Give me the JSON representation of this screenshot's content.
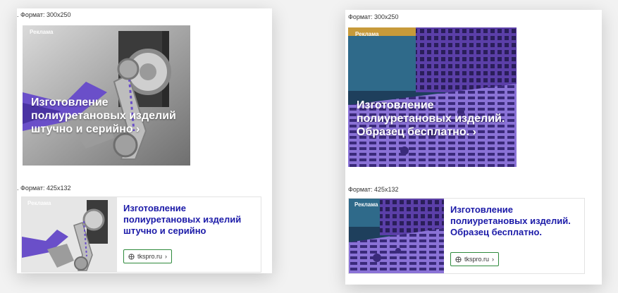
{
  "left": {
    "format_big": ". Формат: 300x250",
    "format_small": ". Формат: 425x132",
    "ad_badge": "Реклама",
    "big_title": "Изготовление полиуретановых изделий штучно и серийно ›",
    "small_title": "Изготовление полиуретановых изделий штучно и серийно",
    "domain": "tkspro.ru",
    "arrow": "›"
  },
  "right": {
    "format_big": "Формат: 300x250",
    "format_small": "Формат: 425x132",
    "ad_badge": "Реклама",
    "big_title": "Изготовление полиуретановых изделий. Образец бесплатно. ›",
    "small_title": "Изготовление полиуретановых изделий. Образец бесплатно.",
    "domain": "tkspro.ru",
    "arrow": "›"
  },
  "colors": {
    "title_blue": "#1b1aa8",
    "button_border": "#2e8a3c",
    "purple_accent": "#6a4fc9"
  },
  "icons": [
    "robot-arm-image",
    "purple-grid-image",
    "globe-icon"
  ]
}
